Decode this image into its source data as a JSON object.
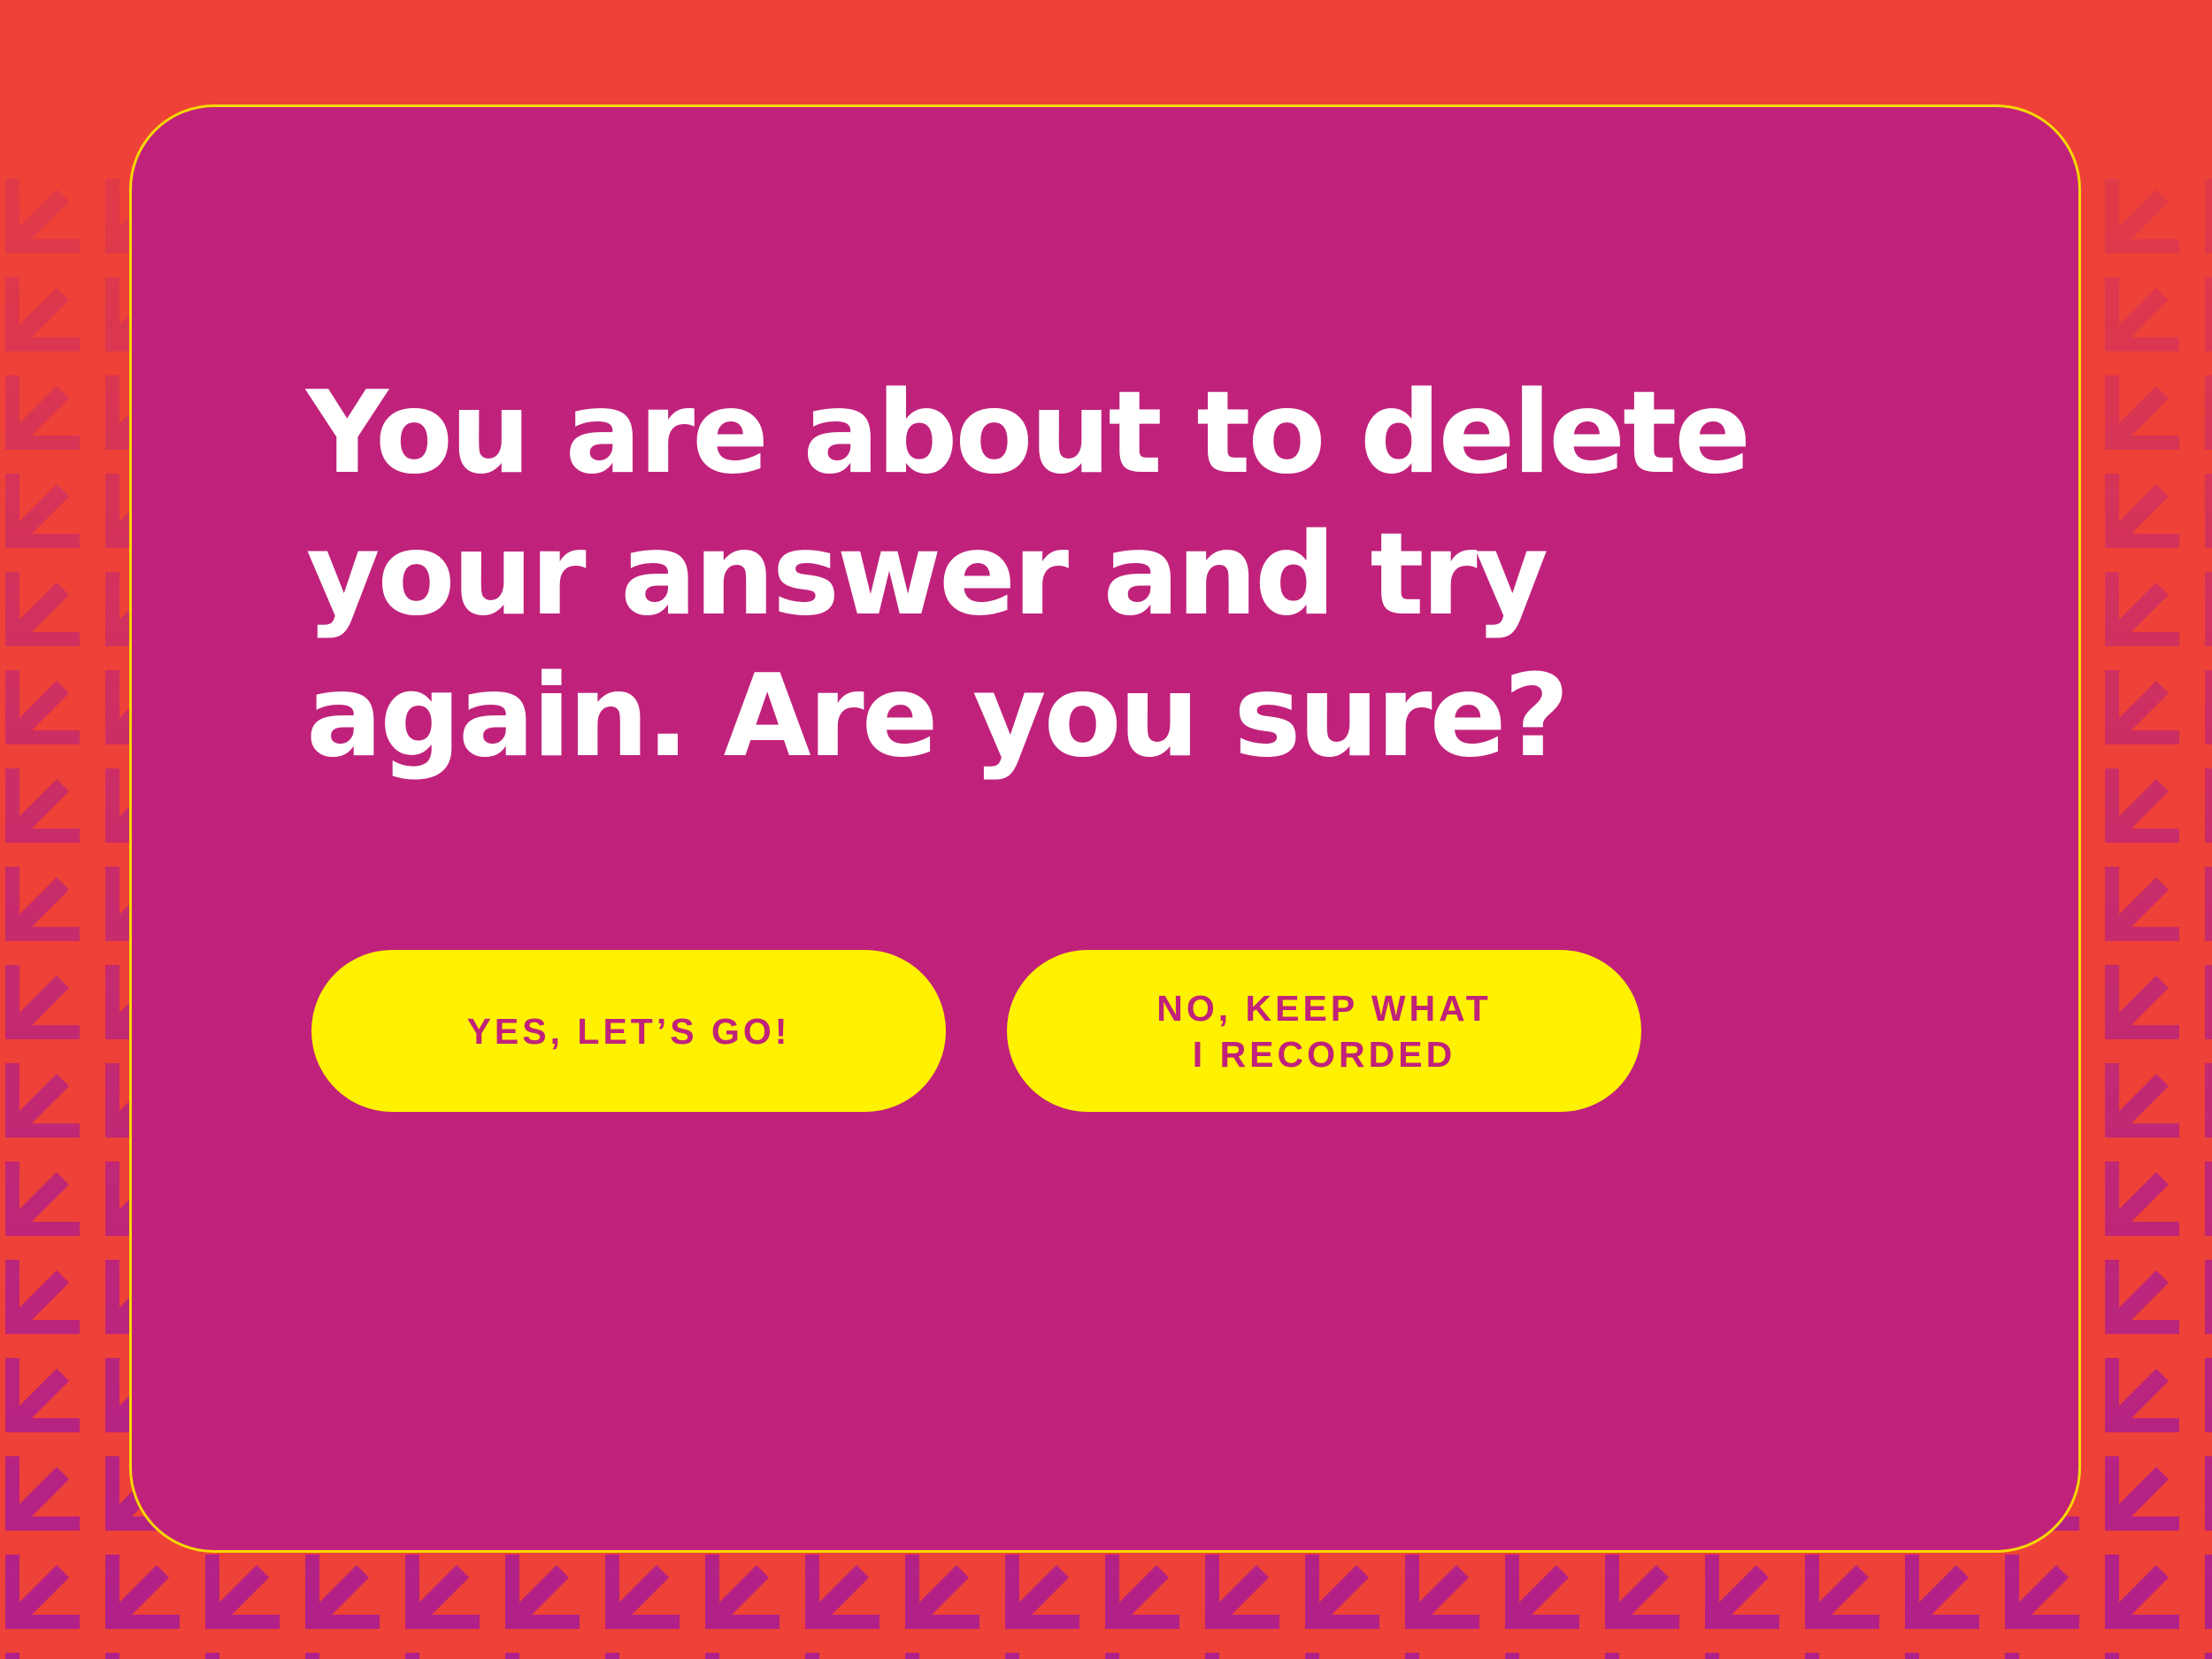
{
  "dialog": {
    "message": "You are about to delete your answer and try again. Are you sure?",
    "confirm_label": "YES, LET’S GO!",
    "cancel_label_line1": "NO, KEEP WHAT",
    "cancel_label_line2": "I RECORDED"
  },
  "colors": {
    "background": "#ee4137",
    "modal": "#c0227b",
    "modal_border": "#f5d800",
    "button": "#fff200",
    "button_text": "#c0227b",
    "arrow_pattern": "#b0208a",
    "message_text": "#ffffff"
  },
  "decor": {
    "pattern_icon": "down-left-arrow-icon"
  }
}
